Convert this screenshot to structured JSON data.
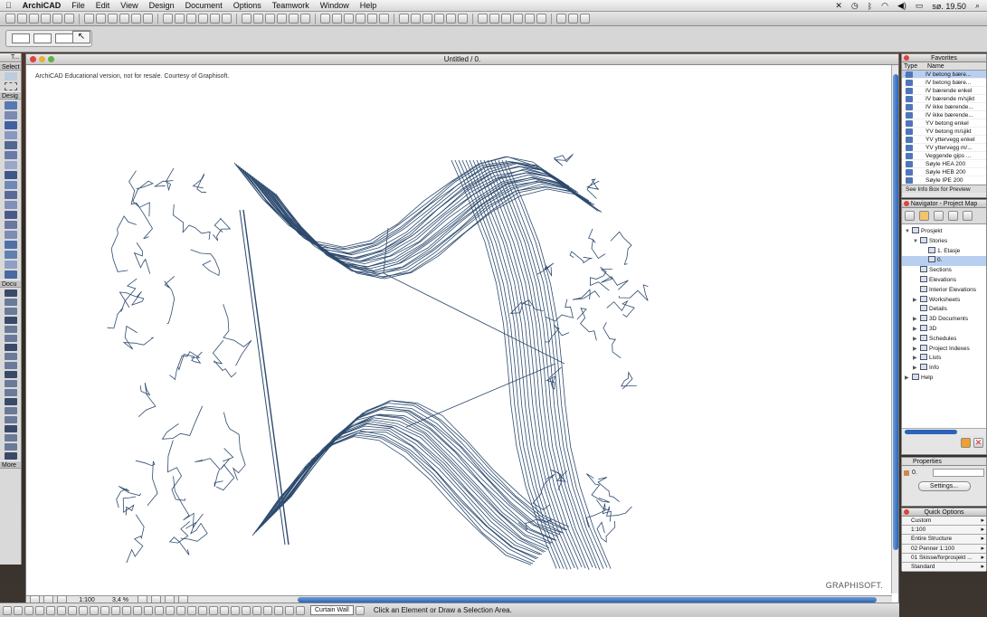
{
  "menubar": {
    "app": "ArchiCAD",
    "items": [
      "File",
      "Edit",
      "View",
      "Design",
      "Document",
      "Options",
      "Teamwork",
      "Window",
      "Help"
    ],
    "clock": "sø. 19.50"
  },
  "document": {
    "title": "Untitled / 0.",
    "watermark": "ArchiCAD Educational version, not for resale. Courtesy of Graphisoft.",
    "brand": "GRAPHISOFT."
  },
  "toolbox": {
    "title": "T...",
    "sections": [
      "Select",
      "Desig",
      "Docu",
      "More"
    ]
  },
  "bottombar": {
    "scale": "1:100",
    "zoom": "3,4 %"
  },
  "status": {
    "curtain_wall": "Curtain Wall",
    "hint": "Click an Element or Draw a Selection Area."
  },
  "favorites": {
    "title": "Favorites",
    "col_type": "Type ▲",
    "col_name": "Name",
    "items": [
      "IV betong bære...",
      "IV betong bære...",
      "IV bærende enkel",
      "IV bærende m/sjikt",
      "IV ikke bærende...",
      "IV ikke bærende...",
      "YV betong enkel",
      "YV betong m/sjikt",
      "YV yttervegg enkel",
      "YV yttervegg m/...",
      "Veggende gips ...",
      "Søyle HEA 200",
      "Søyle HEB 200",
      "Søyle IPE 200"
    ],
    "footer": "See Info Box for Preview"
  },
  "navigator": {
    "title": "Navigator - Project Map",
    "tree": [
      {
        "label": "Prosjekt",
        "level": 0,
        "open": true
      },
      {
        "label": "Stories",
        "level": 1,
        "open": true
      },
      {
        "label": "1. Etasje",
        "level": 2
      },
      {
        "label": "0.",
        "level": 2,
        "selected": true
      },
      {
        "label": "Sections",
        "level": 1
      },
      {
        "label": "Elevations",
        "level": 1
      },
      {
        "label": "Interior Elevations",
        "level": 1
      },
      {
        "label": "Worksheets",
        "level": 1,
        "closed": true
      },
      {
        "label": "Details",
        "level": 1
      },
      {
        "label": "3D Documents",
        "level": 1,
        "closed": true
      },
      {
        "label": "3D",
        "level": 1,
        "closed": true
      },
      {
        "label": "Schedules",
        "level": 1,
        "closed": true
      },
      {
        "label": "Project Indexes",
        "level": 1,
        "closed": true
      },
      {
        "label": "Lists",
        "level": 1,
        "closed": true
      },
      {
        "label": "Info",
        "level": 1,
        "closed": true
      },
      {
        "label": "Help",
        "level": 0,
        "closed": true
      }
    ]
  },
  "properties": {
    "title": "Properties",
    "value": "0.",
    "settings": "Settings..."
  },
  "quick_options": {
    "title": "Quick Options",
    "items": [
      "Custom",
      "1:100",
      "Entire Structure",
      "02 Penner 1:100",
      "01 Skisse/forprosjekt ...",
      "Standard"
    ]
  },
  "colors": {
    "contour": "#2d4a6e",
    "accent": "#2b63b8"
  }
}
